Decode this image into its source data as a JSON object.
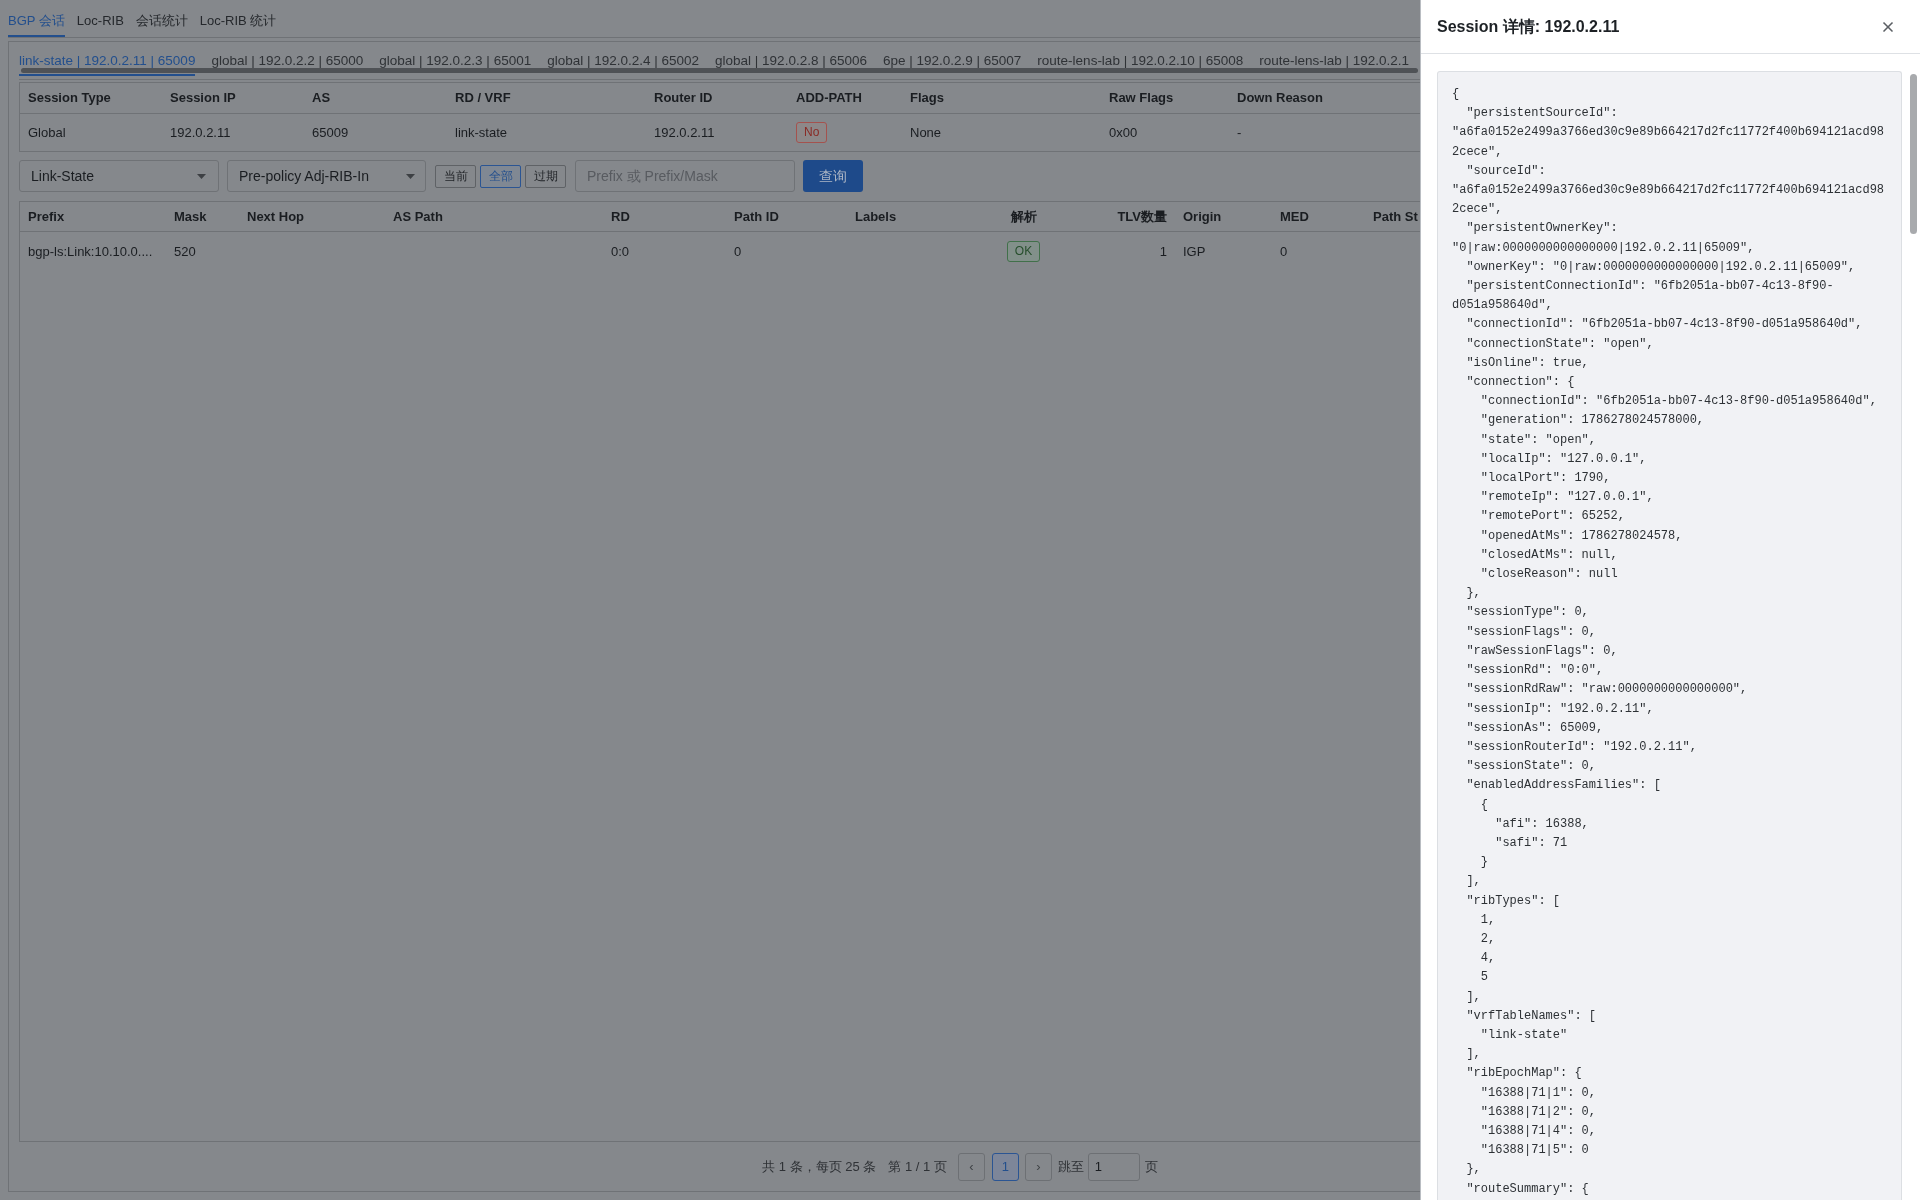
{
  "top_tabs": [
    {
      "label": "BGP 会话",
      "selected": true
    },
    {
      "label": "Loc-RIB",
      "selected": false
    },
    {
      "label": "会话统计",
      "selected": false
    },
    {
      "label": "Loc-RIB 统计",
      "selected": false
    }
  ],
  "session_tabs": [
    {
      "label": "link-state | 192.0.2.11 | 65009",
      "selected": true
    },
    {
      "label": "global | 192.0.2.2 | 65000",
      "selected": false
    },
    {
      "label": "global | 192.0.2.3 | 65001",
      "selected": false
    },
    {
      "label": "global | 192.0.2.4 | 65002",
      "selected": false
    },
    {
      "label": "global | 192.0.2.8 | 65006",
      "selected": false
    },
    {
      "label": "6pe | 192.0.2.9 | 65007",
      "selected": false
    },
    {
      "label": "route-lens-lab | 192.0.2.10 | 65008",
      "selected": false
    },
    {
      "label": "route-lens-lab | 192.0.2.1",
      "selected": false
    }
  ],
  "session_info": {
    "columns": [
      "Session Type",
      "Session IP",
      "AS",
      "RD / VRF",
      "Router ID",
      "ADD-PATH",
      "Flags",
      "Raw Flags",
      "Down Reason"
    ],
    "row": [
      {
        "kind": "text",
        "text": "Global"
      },
      {
        "kind": "text",
        "text": "192.0.2.11"
      },
      {
        "kind": "text",
        "text": "65009"
      },
      {
        "kind": "text",
        "text": "link-state"
      },
      {
        "kind": "text",
        "text": "192.0.2.11"
      },
      {
        "kind": "danger",
        "text": "No"
      },
      {
        "kind": "text",
        "text": "None"
      },
      {
        "kind": "text",
        "text": "0x00"
      },
      {
        "kind": "text",
        "text": "-"
      }
    ]
  },
  "filters": {
    "family_select": {
      "value": "Link-State"
    },
    "rib_select": {
      "value": "Pre-policy Adj-RIB-In"
    },
    "scope_buttons": [
      {
        "label": "当前",
        "selected": false
      },
      {
        "label": "全部",
        "selected": true
      },
      {
        "label": "过期",
        "selected": false
      }
    ],
    "prefix_search": {
      "placeholder": "Prefix 或 Prefix/Mask"
    },
    "query_button": "查询"
  },
  "routes_table": {
    "columns": [
      "Prefix",
      "Mask",
      "Next Hop",
      "AS Path",
      "RD",
      "Path ID",
      "Labels",
      "解析",
      "TLV数量",
      "Origin",
      "MED",
      "Path St"
    ],
    "rows": [
      {
        "cells": [
          {
            "kind": "text",
            "text": "bgp-ls:Link:10.10.0...."
          },
          {
            "kind": "text",
            "text": "520"
          },
          {
            "kind": "empty"
          },
          {
            "kind": "empty"
          },
          {
            "kind": "text",
            "text": "0:0"
          },
          {
            "kind": "text",
            "text": "0"
          },
          {
            "kind": "empty"
          },
          {
            "kind": "success",
            "text": "OK"
          },
          {
            "kind": "text",
            "text": "1"
          },
          {
            "kind": "text",
            "text": "IGP"
          },
          {
            "kind": "text",
            "text": "0"
          }
        ]
      }
    ]
  },
  "pagination": {
    "summary": "共 1 条，每页 25 条",
    "page_info": "第 1 / 1 页",
    "prev": "‹",
    "pages": [
      {
        "label": "1",
        "selected": true
      }
    ],
    "next": "›",
    "jump_label": "跳至",
    "jump_value": "1",
    "jump_suffix": "页"
  },
  "drawer": {
    "title": "Session 详情: 192.0.2.11",
    "code_lines": [
      "{",
      "  \"persistentSourceId\":",
      "\"a6fa0152e2499a3766ed30c9e89b664217d2fc11772f400b694121acd98",
      "2cece\",",
      "  \"sourceId\":",
      "\"a6fa0152e2499a3766ed30c9e89b664217d2fc11772f400b694121acd98",
      "2cece\",",
      "  \"persistentOwnerKey\":",
      "\"0|raw:0000000000000000|192.0.2.11|65009\",",
      "  \"ownerKey\": \"0|raw:0000000000000000|192.0.2.11|65009\",",
      "  \"persistentConnectionId\": \"6fb2051a-bb07-4c13-8f90-",
      "d051a958640d\",",
      "  \"connectionId\": \"6fb2051a-bb07-4c13-8f90-d051a958640d\",",
      "  \"connectionState\": \"open\",",
      "  \"isOnline\": true,",
      "  \"connection\": {",
      "    \"connectionId\": \"6fb2051a-bb07-4c13-8f90-d051a958640d\",",
      "    \"generation\": 1786278024578000,",
      "    \"state\": \"open\",",
      "    \"localIp\": \"127.0.0.1\",",
      "    \"localPort\": 1790,",
      "    \"remoteIp\": \"127.0.0.1\",",
      "    \"remotePort\": 65252,",
      "    \"openedAtMs\": 1786278024578,",
      "    \"closedAtMs\": null,",
      "    \"closeReason\": null",
      "  },",
      "  \"sessionType\": 0,",
      "  \"sessionFlags\": 0,",
      "  \"rawSessionFlags\": 0,",
      "  \"sessionRd\": \"0:0\",",
      "  \"sessionRdRaw\": \"raw:0000000000000000\",",
      "  \"sessionIp\": \"192.0.2.11\",",
      "  \"sessionAs\": 65009,",
      "  \"sessionRouterId\": \"192.0.2.11\",",
      "  \"sessionState\": 0,",
      "  \"enabledAddressFamilies\": [",
      "    {",
      "      \"afi\": 16388,",
      "      \"safi\": 71",
      "    }",
      "  ],",
      "  \"ribTypes\": [",
      "    1,",
      "    2,",
      "    4,",
      "    5",
      "  ],",
      "  \"vrfTableNames\": [",
      "    \"link-state\"",
      "  ],",
      "  \"ribEpochMap\": {",
      "    \"16388|71|1\": 0,",
      "    \"16388|71|2\": 0,",
      "    \"16388|71|4\": 0,",
      "    \"16388|71|5\": 0",
      "  },",
      "  \"routeSummary\": {"
    ]
  }
}
